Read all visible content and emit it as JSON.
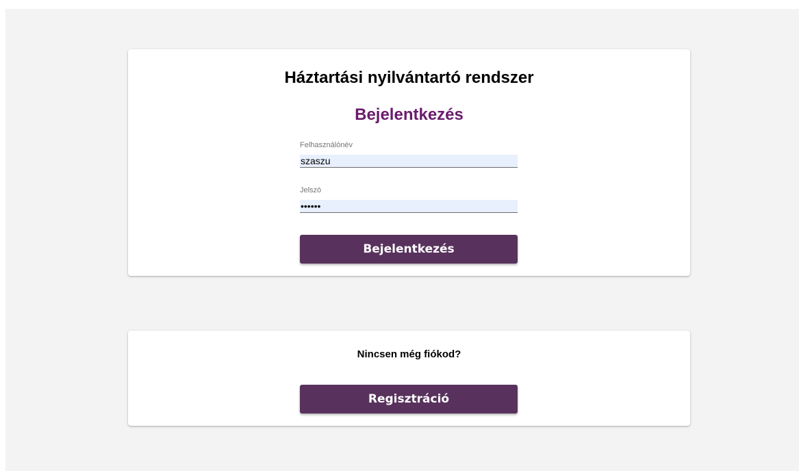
{
  "login": {
    "app_title": "Háztartási nyilvántartó rendszer",
    "title": "Bejelentkezés",
    "username": {
      "label": "Felhasználónév",
      "value": "szaszu"
    },
    "password": {
      "label": "Jelszó",
      "value": "••••••"
    },
    "submit_label": "Bejelentkezés"
  },
  "register": {
    "prompt": "Nincsen még fiókod?",
    "button_label": "Regisztráció"
  },
  "colors": {
    "page_background": "#f3f3f3",
    "title_accent": "#6a1b6e",
    "button": "#58325d",
    "autofill_background": "#e8f0fe"
  }
}
